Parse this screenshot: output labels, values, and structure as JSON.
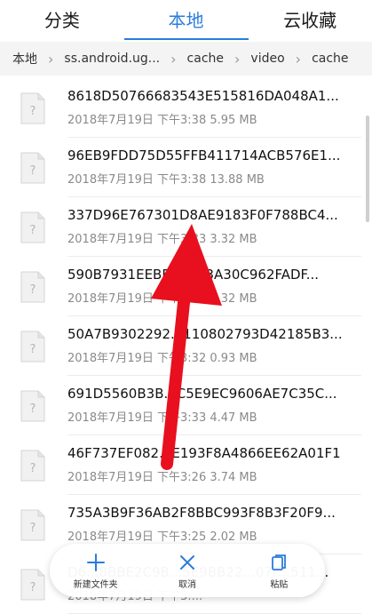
{
  "tabs": {
    "items": [
      {
        "label": "分类"
      },
      {
        "label": "本地"
      },
      {
        "label": "云收藏"
      }
    ],
    "active_index": 1
  },
  "breadcrumb": {
    "items": [
      {
        "label": "本地"
      },
      {
        "label": "ss.android.ug..."
      },
      {
        "label": "cache"
      },
      {
        "label": "video"
      },
      {
        "label": "cache"
      }
    ]
  },
  "files": [
    {
      "name": "8618D50766683543E515816DA048A1...",
      "meta": "2018年7月19日 下午3:38 5.95 MB"
    },
    {
      "name": "96EB9FDD75D55FFB411714ACB576E1...",
      "meta": "2018年7月19日 下午3:38 13.88 MB"
    },
    {
      "name": "337D96E767301D8AE9183F0F788BC4...",
      "meta": "2018年7月19日 下午3:33 3.32 MB"
    },
    {
      "name": "590B7931EEBF...0393A30C962FADF...",
      "meta": "2018年7月19日 下午3:38 7.32 MB"
    },
    {
      "name": "50A7B9302292...110802793D42185B3...",
      "meta": "2018年7月19日 下午3:32 0.93 MB"
    },
    {
      "name": "691D5560B3B...C5E9EC9606AE7C35C...",
      "meta": "2018年7月19日 下午3:33 4.47 MB"
    },
    {
      "name": "46F737EF082...E193F8A4866EE62A01F1",
      "meta": "2018年7月19日 下午3:26 3.74 MB"
    },
    {
      "name": "735A3B9F36AB2F8BBC993F8B3F20F9...",
      "meta": "2018年7月19日 下午3:25 2.02 MB"
    },
    {
      "name": "D6...8BBE2C9B...5E9BB22...07F...511...",
      "meta": "2018年7月19日 下午3:..."
    }
  ],
  "actions": {
    "new_folder": "新建文件夹",
    "cancel": "取消",
    "paste": "粘贴"
  },
  "colors": {
    "accent": "#2a7cdc",
    "arrow": "#e8101e"
  }
}
